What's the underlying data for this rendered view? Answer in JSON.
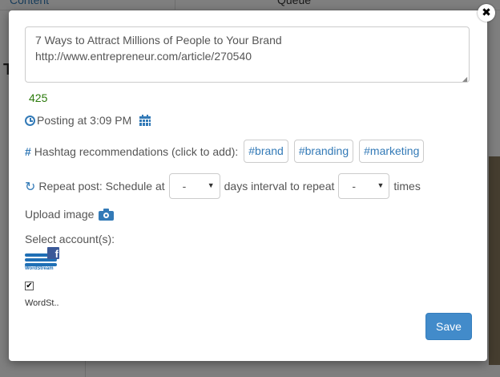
{
  "background": {
    "tab_content": "Content",
    "tab_queue": "Queue",
    "left_letter": "T"
  },
  "modal": {
    "compose_text": "7 Ways to Attract Millions of People to Your Brand\nhttp://www.entrepreneur.com/article/270540",
    "char_count": "425",
    "posting_label": "Posting at 3:09 PM",
    "hashtag_label": "Hashtag recommendations (click to add):",
    "hashtags": [
      "#brand",
      "#branding",
      "#marketing"
    ],
    "repeat": {
      "label_prefix": "Repeat post: Schedule at",
      "select_days_value": "-",
      "label_middle": "days interval to repeat",
      "select_times_value": "-",
      "label_suffix": "times"
    },
    "upload_label": "Upload image",
    "select_accounts_label": "Select account(s):",
    "account": {
      "logo_text": "WordStream",
      "network_badge": "f",
      "checked_mark": "✔",
      "name": "WordSt.."
    },
    "save_label": "Save",
    "close_symbol": "✖"
  },
  "colors": {
    "accent": "#337ab7",
    "primary_button": "#428bca",
    "count_green": "#2b7a0b",
    "facebook": "#3b5998"
  }
}
